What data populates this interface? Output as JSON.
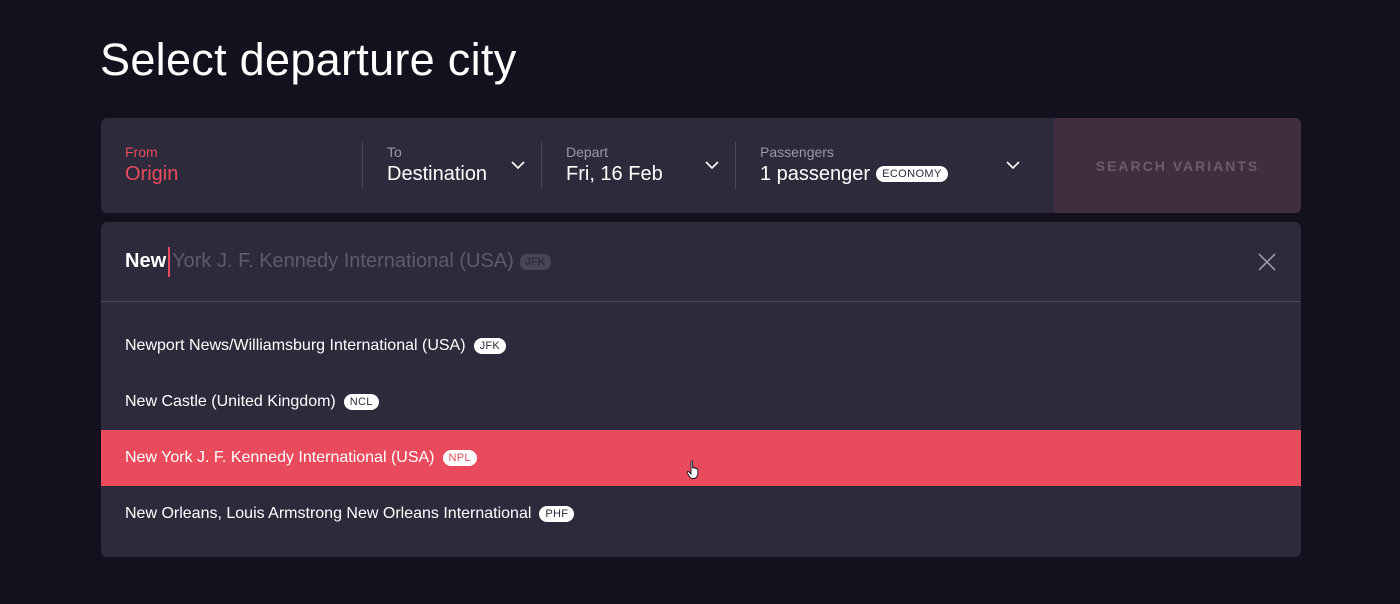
{
  "page": {
    "title": "Select departure city"
  },
  "search_bar": {
    "from": {
      "label": "From",
      "value": "Origin"
    },
    "to": {
      "label": "To",
      "value": "Destination"
    },
    "depart": {
      "label": "Depart",
      "value": "Fri, 16 Feb"
    },
    "passengers": {
      "label": "Passengers",
      "value": "1 passenger",
      "class_badge": "ECONOMY"
    },
    "search_button": "SEARCH VARIANTS"
  },
  "autocomplete": {
    "typed": "New",
    "hint": "York J. F. Kennedy International (USA)",
    "hint_code": "JFK",
    "results": [
      {
        "name": "Newport News/Williamsburg International (USA)",
        "code": "JFK"
      },
      {
        "name": "New Castle (United Kingdom)",
        "code": "NCL"
      },
      {
        "name": "New York J. F. Kennedy International (USA)",
        "code": "NPL"
      },
      {
        "name": "New Orleans, Louis Armstrong New Orleans International",
        "code": "PHF"
      }
    ]
  },
  "colors": {
    "background": "#14111f",
    "panel": "#2d2a3b",
    "accent": "#e94b5c",
    "muted_text": "#9c98ab"
  },
  "icons": [
    "chevron-down-icon",
    "close-icon",
    "hand-pointer-icon"
  ]
}
